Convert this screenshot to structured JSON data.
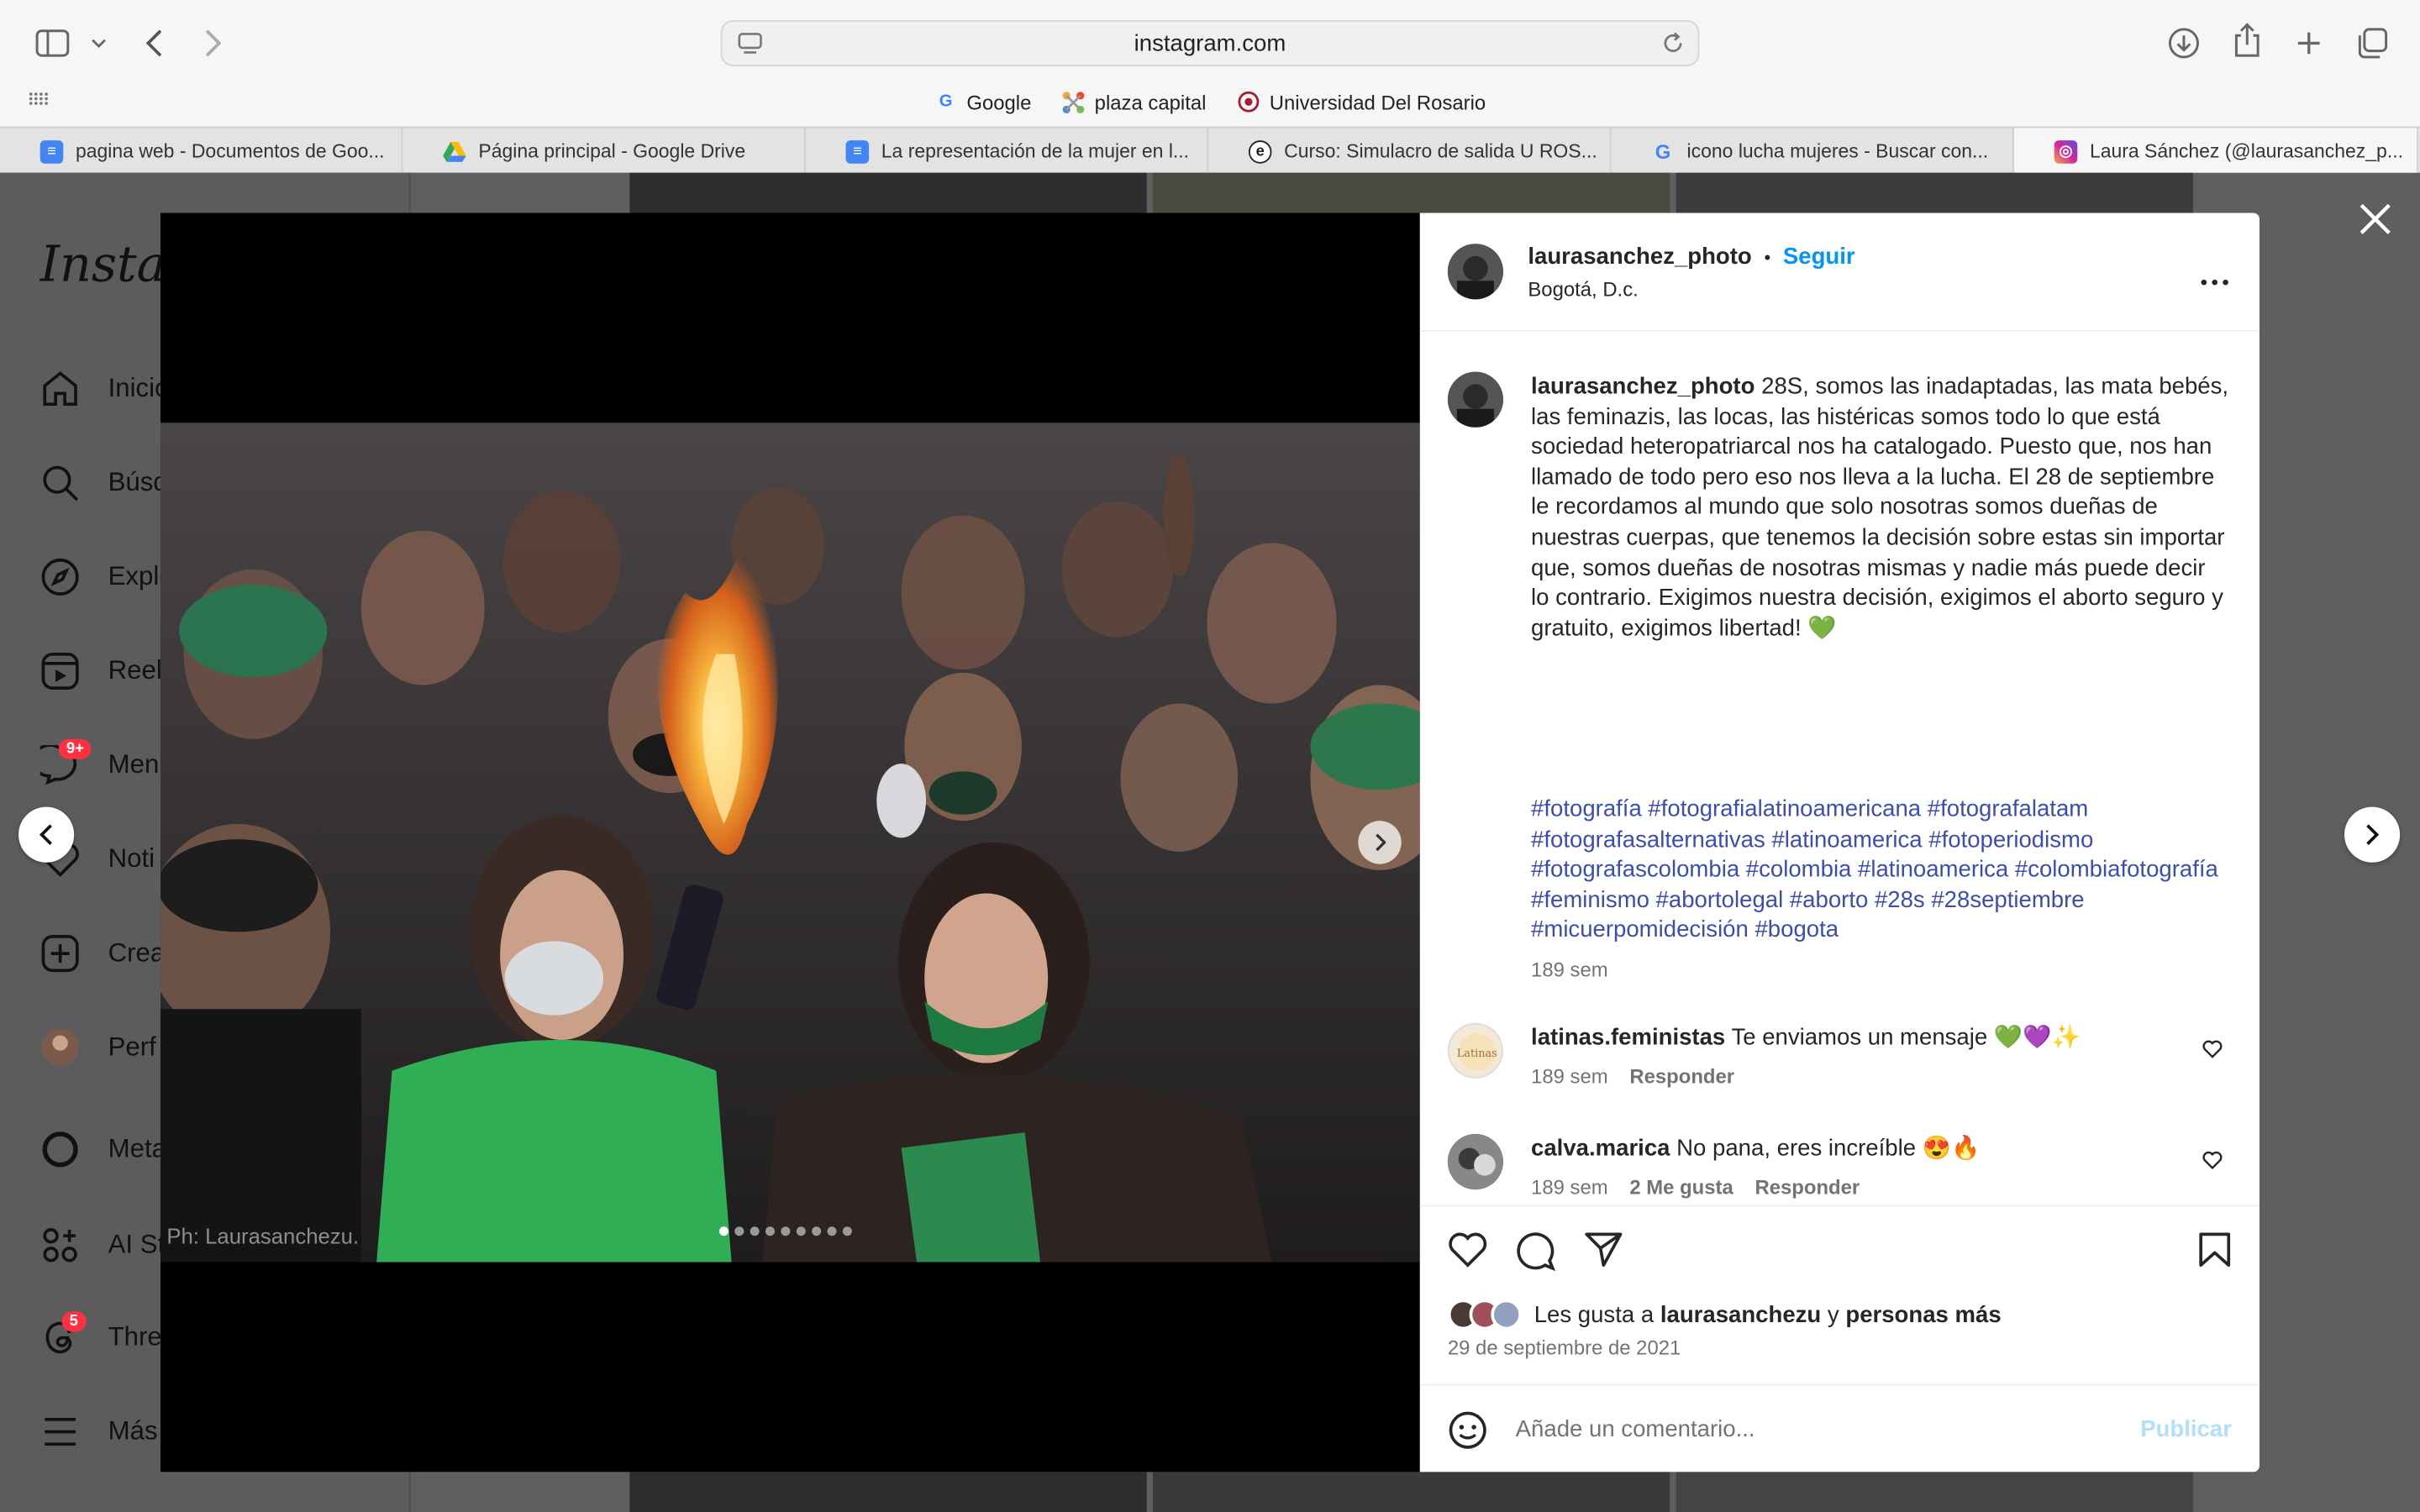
{
  "browser": {
    "url": "instagram.com",
    "favorites": [
      {
        "label": "Google",
        "icon": "google-icon",
        "color": "#4285f4"
      },
      {
        "label": "plaza capital",
        "icon": "joomla-icon",
        "color": "#f44321"
      },
      {
        "label": "Universidad Del Rosario",
        "icon": "rosario-crest-icon",
        "color": "#a6192e"
      }
    ],
    "tabs": [
      {
        "label": "pagina web - Documentos de Goo...",
        "icon": "google-docs-icon",
        "color": "#4285f4"
      },
      {
        "label": "Página principal - Google Drive",
        "icon": "google-drive-icon",
        "color": "#34a853"
      },
      {
        "label": "La representación de la mujer en l...",
        "icon": "google-docs-icon",
        "color": "#4285f4"
      },
      {
        "label": "Curso: Simulacro de salida U ROS...",
        "icon": "e-learning-icon",
        "color": "#222222"
      },
      {
        "label": "icono lucha mujeres - Buscar con...",
        "icon": "google-icon",
        "color": "#4285f4"
      },
      {
        "label": "Laura Sánchez (@laurasanchez_p...",
        "icon": "instagram-icon",
        "color": "#d6249f"
      }
    ]
  },
  "sidebar": {
    "logo": "Instagr",
    "items": [
      {
        "label": "Inicio",
        "icon": "home-icon"
      },
      {
        "label": "Búsq",
        "icon": "search-icon"
      },
      {
        "label": "Explo",
        "icon": "explore-icon"
      },
      {
        "label": "Reel",
        "icon": "reels-icon"
      },
      {
        "label": "Men",
        "icon": "messenger-icon",
        "badge": "9+"
      },
      {
        "label": "Noti",
        "icon": "heart-icon"
      },
      {
        "label": "Crea",
        "icon": "create-icon"
      },
      {
        "label": "Perf",
        "icon": "profile-avatar"
      },
      {
        "label": "Meta",
        "icon": "meta-ai-icon"
      },
      {
        "label": "AI St",
        "icon": "ai-studio-icon"
      },
      {
        "label": "Thre",
        "icon": "threads-icon",
        "badge": "5"
      },
      {
        "label": "Más",
        "icon": "menu-icon"
      }
    ]
  },
  "post": {
    "username": "laurasanchez_photo",
    "separator": "•",
    "follow": "Seguir",
    "location": "Bogotá, D.c.",
    "caption_user": "laurasanchez_photo",
    "caption": "28S, somos las inadaptadas, las mata bebés, las feminazis, las locas, las histéricas somos todo lo que está sociedad heteropatriarcal nos ha catalogado. Puesto que, nos han llamado de todo pero eso nos lleva a la lucha. El 28 de septiembre le recordamos al mundo que solo nosotras somos dueñas de nuestras cuerpas, que tenemos la decisión sobre estas sin importar que, somos dueñas de nosotras mismas y nadie más puede decir lo contrario. Exigimos nuestra decisión, exigimos el aborto seguro y gratuito, exigimos libertad! 💚",
    "hashtags": "#fotografía #fotografialatinoamericana #fotografalatam #fotografasalternativas #latinoamerica #fotoperiodismo #fotografascolombia #colombia #latinoamerica #colombiafotografía #feminismo #abortolegal #aborto #28s #28septiembre #micuerpomidecisión #bogota",
    "caption_time": "189 sem",
    "photo_credit": "Ph:  Laurasanchezu.",
    "carousel_total": 9,
    "carousel_current": 1,
    "comments": [
      {
        "user": "latinas.feministas",
        "text": "Te enviamos un mensaje 💚💜✨",
        "time": "189 sem",
        "likes": "",
        "reply": "Responder"
      },
      {
        "user": "calva.marica",
        "text": "No pana, eres increíble 😍🔥",
        "time": "189 sem",
        "likes": "2 Me gusta",
        "reply": "Responder"
      }
    ],
    "likes_prefix": "Les gusta a",
    "likes_user": "laurasanchezu",
    "likes_join": "y",
    "likes_rest": "personas más",
    "date": "29 de septiembre de 2021",
    "comment_placeholder": "Añade un comentario...",
    "publish": "Publicar"
  },
  "colors": {
    "link": "#0095f6",
    "hashtag": "#3b4db5",
    "badge": "#ff3040"
  }
}
